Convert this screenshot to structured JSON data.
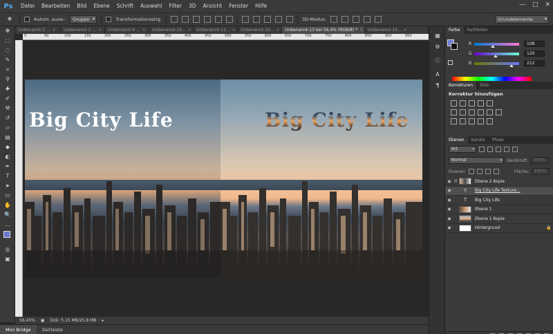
{
  "app": {
    "logo": "Ps",
    "menu": [
      "Datei",
      "Bearbeiten",
      "Bild",
      "Ebene",
      "Schrift",
      "Auswahl",
      "Filter",
      "3D",
      "Ansicht",
      "Fenster",
      "Hilfe"
    ],
    "window_controls": {
      "minimize": "—",
      "maximize": "□",
      "close": "✕"
    }
  },
  "options_bar": {
    "auto_select_label": "Autom. ausw.:",
    "auto_select_value": "Gruppe",
    "transform_controls_label": "Transformationsstrg.",
    "mode_3d_label": "3D-Modus:",
    "workspace": "Grundelemente"
  },
  "tabs": [
    {
      "label": "Unbenannt-2 ...",
      "active": false
    },
    {
      "label": "Unbenannt-3 ...",
      "active": false
    },
    {
      "label": "Unbenannt-4 ...",
      "active": false
    },
    {
      "label": "Unbenannt-10...",
      "active": false
    },
    {
      "label": "Unbenannt-11...",
      "active": false
    },
    {
      "label": "Unbenannt-12...",
      "active": false
    },
    {
      "label": "Unbenannt-13 bei 56,4% (RGB/8) *",
      "active": true
    },
    {
      "label": "Unbenannt-14...",
      "active": false
    }
  ],
  "tab_close_glyph": "×",
  "ruler_numbers": [
    "0",
    "50",
    "100",
    "150",
    "200",
    "250",
    "300",
    "350",
    "400",
    "450",
    "500",
    "550",
    "600",
    "650",
    "700",
    "750",
    "800",
    "850",
    "900",
    "950"
  ],
  "canvas": {
    "headline_left": "Big City Life",
    "headline_right": "Big City Life"
  },
  "status": {
    "zoom": "56,45%",
    "doc_info": "Dok: 5,15 MB/25,8 MB"
  },
  "bottom_tabs": [
    "Mini Bridge",
    "Zeitleiste"
  ],
  "color_panel": {
    "tabs": [
      "Farbe",
      "Farbfelder"
    ],
    "r": {
      "label": "R",
      "value": "108",
      "fraction": 0.42
    },
    "g": {
      "label": "G",
      "value": "120",
      "fraction": 0.47
    },
    "b": {
      "label": "B",
      "value": "212",
      "fraction": 0.83
    },
    "foreground": "#6c78d4"
  },
  "adjustments_panel": {
    "tabs": [
      "Korrekturen",
      "Stile"
    ],
    "title": "Korrektur hinzufügen"
  },
  "layers_panel": {
    "tabs": [
      "Ebenen",
      "Kanäle",
      "Pfade"
    ],
    "filter_kind": "Art",
    "blend_mode": "Normal",
    "opacity_label": "Deckkraft:",
    "opacity_value": "100%",
    "lock_label": "Fixieren:",
    "fill_label": "Fläche:",
    "fill_value": "100%",
    "eye_glyph": "◉",
    "link_glyph": "⛓",
    "lock_glyph": "🔒",
    "text_thumb_glyph": "T",
    "layers": [
      {
        "name": "Ebene 2 Kopie",
        "kind": "image",
        "linked": true,
        "selected": false
      },
      {
        "name": "Big City Life Texture...",
        "kind": "text",
        "linked": false,
        "selected": true
      },
      {
        "name": "Big City Life",
        "kind": "text",
        "linked": false,
        "selected": false
      },
      {
        "name": "Ebene 1",
        "kind": "image",
        "linked": false,
        "selected": false
      },
      {
        "name": "Ebene 1 Kopie",
        "kind": "image",
        "linked": false,
        "selected": false
      },
      {
        "name": "Hintergrund",
        "kind": "background",
        "linked": false,
        "selected": false,
        "locked": true
      }
    ]
  }
}
